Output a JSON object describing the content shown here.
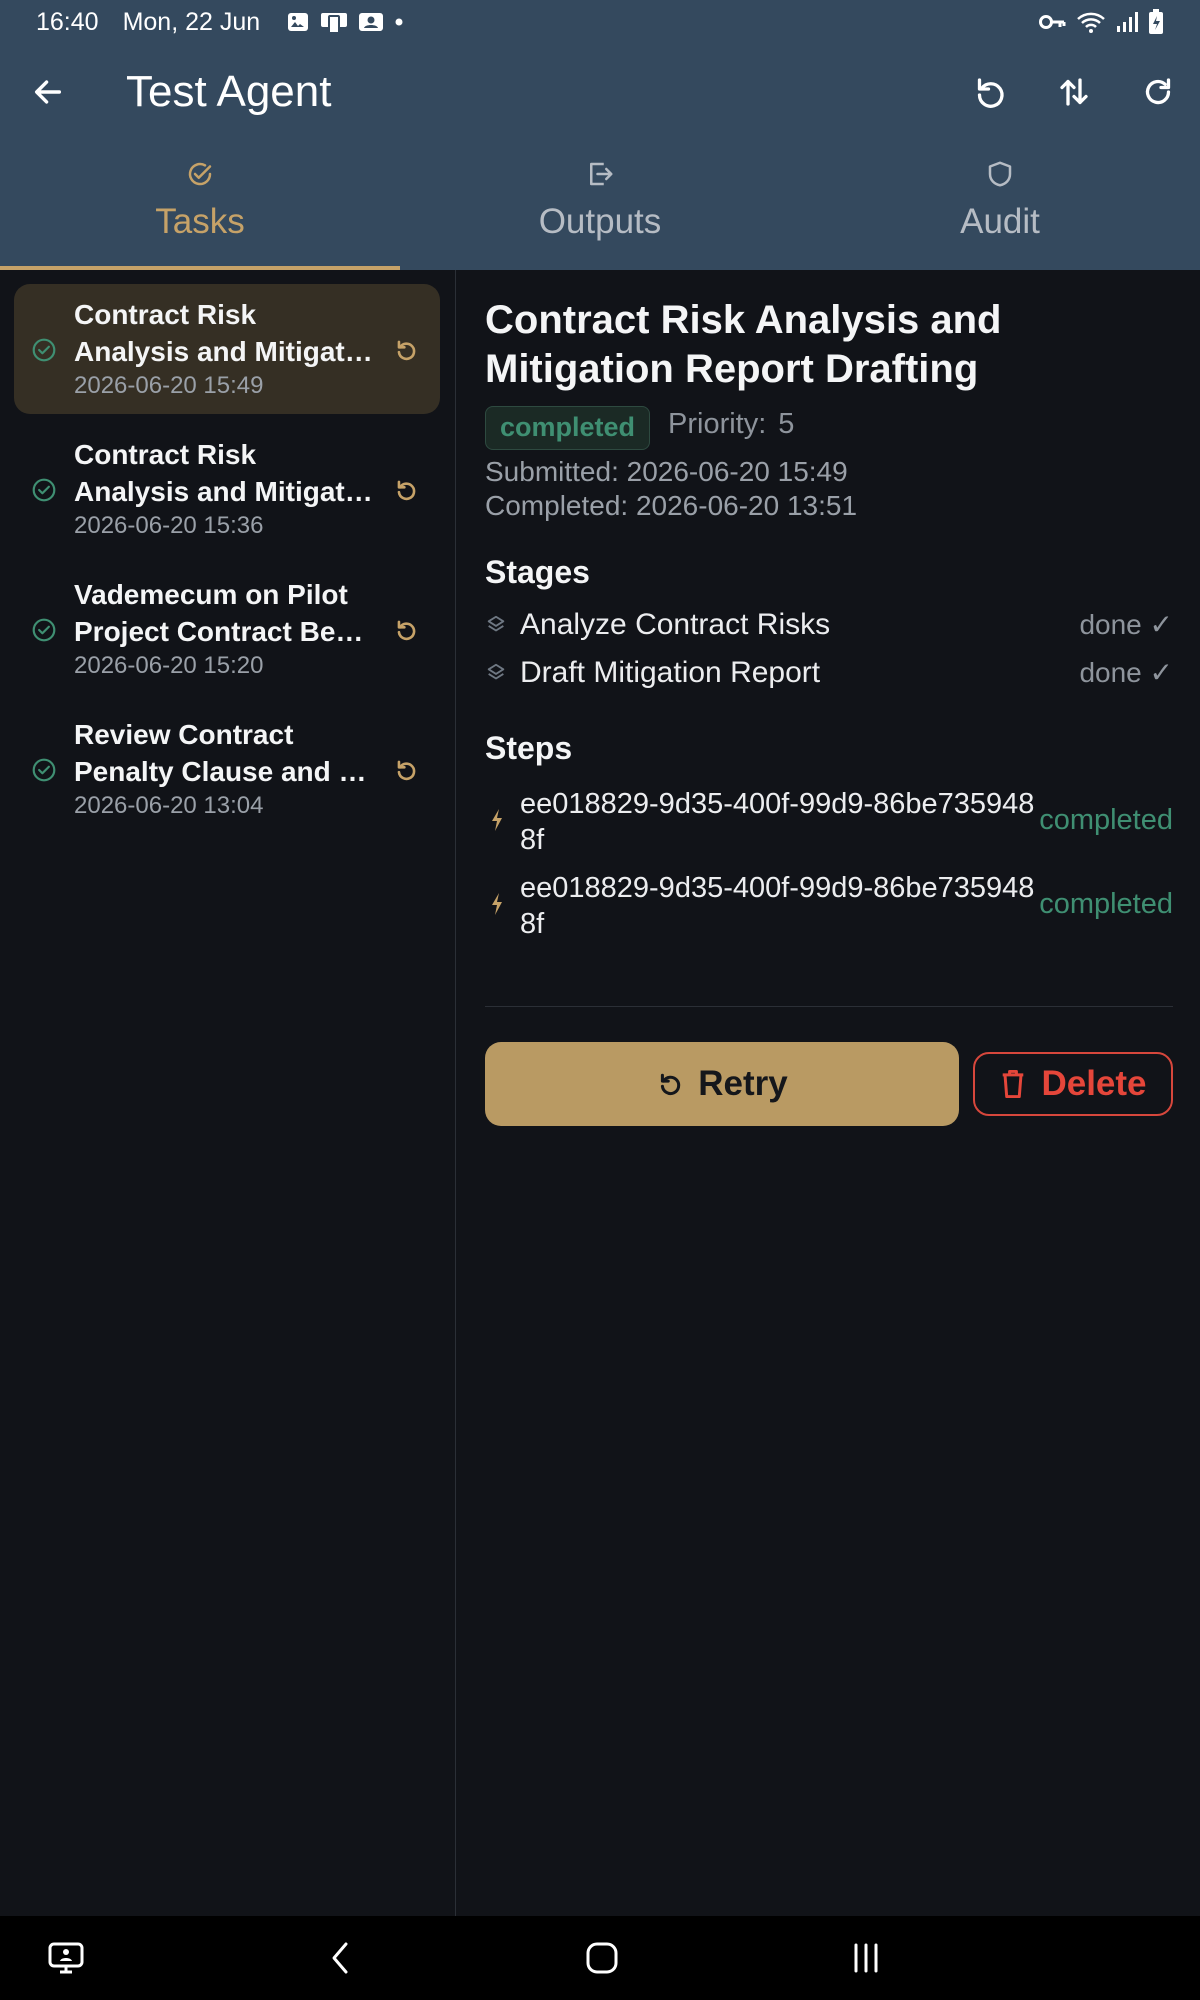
{
  "status_bar": {
    "time": "16:40",
    "date": "Mon, 22 Jun"
  },
  "app_bar": {
    "title": "Test Agent",
    "icons": [
      "back-arrow-icon",
      "undo-icon",
      "sort-icon",
      "refresh-icon"
    ]
  },
  "tabs": [
    {
      "label": "Tasks",
      "icon": "check-circle-icon",
      "active": true
    },
    {
      "label": "Outputs",
      "icon": "export-icon",
      "active": false
    },
    {
      "label": "Audit",
      "icon": "shield-icon",
      "active": false
    }
  ],
  "tasks": [
    {
      "title_line1": "Contract Risk",
      "title_line2": "Analysis and Mitigation Report Drafting",
      "time": "2026-06-20 15:49",
      "selected": true
    },
    {
      "title_line1": "Contract Risk",
      "title_line2": "Analysis and Mitigation Report Drafting",
      "time": "2026-06-20 15:36",
      "selected": false
    },
    {
      "title_line1": "Vademecum on Pilot",
      "title_line2": "Project Contract Benefits",
      "time": "2026-06-20 15:20",
      "selected": false
    },
    {
      "title_line1": "Review Contract",
      "title_line2": "Penalty Clause and Terms",
      "time": "2026-06-20 13:04",
      "selected": false
    }
  ],
  "detail": {
    "title": "Contract Risk Analysis and Mitigation Report Drafting",
    "status": "completed",
    "priority_label": "Priority:",
    "priority_value": "5",
    "submitted": "Submitted: 2026-06-20 15:49",
    "completed": "Completed: 2026-06-20 13:51",
    "stages_heading": "Stages",
    "stages": [
      {
        "label": "Analyze Contract Risks",
        "state": "done ✓"
      },
      {
        "label": "Draft Mitigation Report",
        "state": "done ✓"
      }
    ],
    "steps_heading": "Steps",
    "steps": [
      {
        "id": "ee018829-9d35-400f-99d9-86be7359488f",
        "state": "completed"
      },
      {
        "id": "ee018829-9d35-400f-99d9-86be7359488f",
        "state": "completed"
      }
    ],
    "retry_label": "Retry",
    "delete_label": "Delete"
  },
  "colors": {
    "app_bar": "#34495E",
    "background": "#111318",
    "accent": "#C6A268",
    "retry_button": "#B99A63",
    "success": "#3F8F72",
    "danger": "#E5463A"
  }
}
